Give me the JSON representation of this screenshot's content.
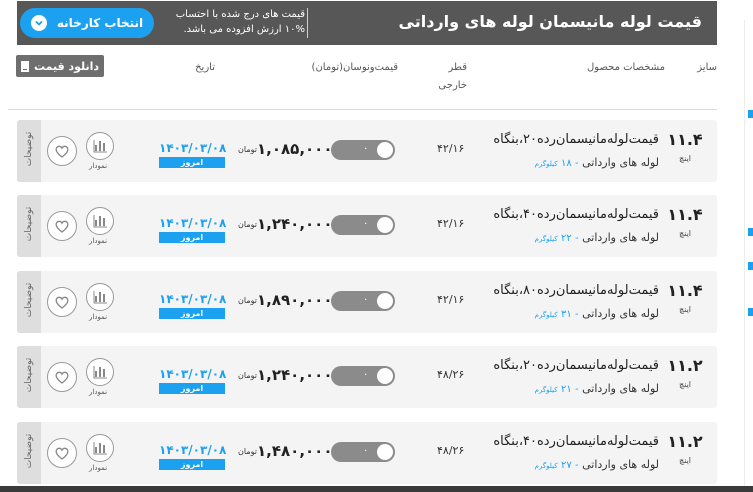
{
  "header": {
    "title": "قیمت لوله مانیسمان لوله های وارداتی",
    "note_line1": "قیمت های درج شده با احتساب",
    "note_line2": "۱۰% ارزش افزوده می باشد.",
    "factory_button": "انتخاب کارخانه"
  },
  "columns": {
    "size": "سایز",
    "spec": "مشخصات محصول",
    "diameter_line1": "قطر",
    "diameter_line2": "خارجی",
    "price": "قیمت‌ونوسان(تومان)",
    "date": "تاریخ"
  },
  "download_button": "دانلود قیمت",
  "rows": [
    {
      "size": "۱۱.۴",
      "size_unit": "اینچ",
      "name": "قیمت‌لوله‌مانیسمان‌رده۲۰،بنگاه",
      "line": "لوله های وارداتی",
      "weight": "۱۸",
      "weight_unit": "کیلوگرم",
      "diameter": "۴۲/۱۶",
      "change": "۰",
      "price": "۱,۰۸۵,۰۰۰",
      "currency": "تومان",
      "date": "۱۴۰۳/۰۳/۰۸",
      "today": "امروز",
      "chart_label": "نمودار",
      "side_label": "توضیحات"
    },
    {
      "size": "۱۱.۴",
      "size_unit": "اینچ",
      "name": "قیمت‌لوله‌مانیسمان‌رده۴۰،بنگاه",
      "line": "لوله های وارداتی",
      "weight": "۲۲",
      "weight_unit": "کیلوگرم",
      "diameter": "۴۲/۱۶",
      "change": "۰",
      "price": "۱,۲۴۰,۰۰۰",
      "currency": "تومان",
      "date": "۱۴۰۳/۰۳/۰۸",
      "today": "امروز",
      "chart_label": "نمودار",
      "side_label": "توضیحات"
    },
    {
      "size": "۱۱.۴",
      "size_unit": "اینچ",
      "name": "قیمت‌لوله‌مانیسمان‌رده۸۰،بنگاه",
      "line": "لوله های وارداتی",
      "weight": "۳۱",
      "weight_unit": "کیلوگرم",
      "diameter": "۴۲/۱۶",
      "change": "۰",
      "price": "۱,۸۹۰,۰۰۰",
      "currency": "تومان",
      "date": "۱۴۰۳/۰۳/۰۸",
      "today": "امروز",
      "chart_label": "نمودار",
      "side_label": "توضیحات"
    },
    {
      "size": "۱۱.۲",
      "size_unit": "اینچ",
      "name": "قیمت‌لوله‌مانیسمان‌رده۲۰،بنگاه",
      "line": "لوله های وارداتی",
      "weight": "۲۱",
      "weight_unit": "کیلوگرم",
      "diameter": "۴۸/۲۶",
      "change": "۰",
      "price": "۱,۲۴۰,۰۰۰",
      "currency": "تومان",
      "date": "۱۴۰۳/۰۳/۰۸",
      "today": "امروز",
      "chart_label": "نمودار",
      "side_label": "توضیحات"
    },
    {
      "size": "۱۱.۲",
      "size_unit": "اینچ",
      "name": "قیمت‌لوله‌مانیسمان‌رده۴۰،بنگاه",
      "line": "لوله های وارداتی",
      "weight": "۲۷",
      "weight_unit": "کیلوگرم",
      "diameter": "۴۸/۲۶",
      "change": "۰",
      "price": "۱,۴۸۰,۰۰۰",
      "currency": "تومان",
      "date": "۱۴۰۳/۰۳/۰۸",
      "today": "امروز",
      "chart_label": "نمودار",
      "side_label": "توضیحات"
    }
  ],
  "colors": {
    "accent": "#1ba1ef",
    "header_bg": "#575757",
    "row_bg": "#f4f4f4",
    "toggle": "#8b8b8b"
  }
}
